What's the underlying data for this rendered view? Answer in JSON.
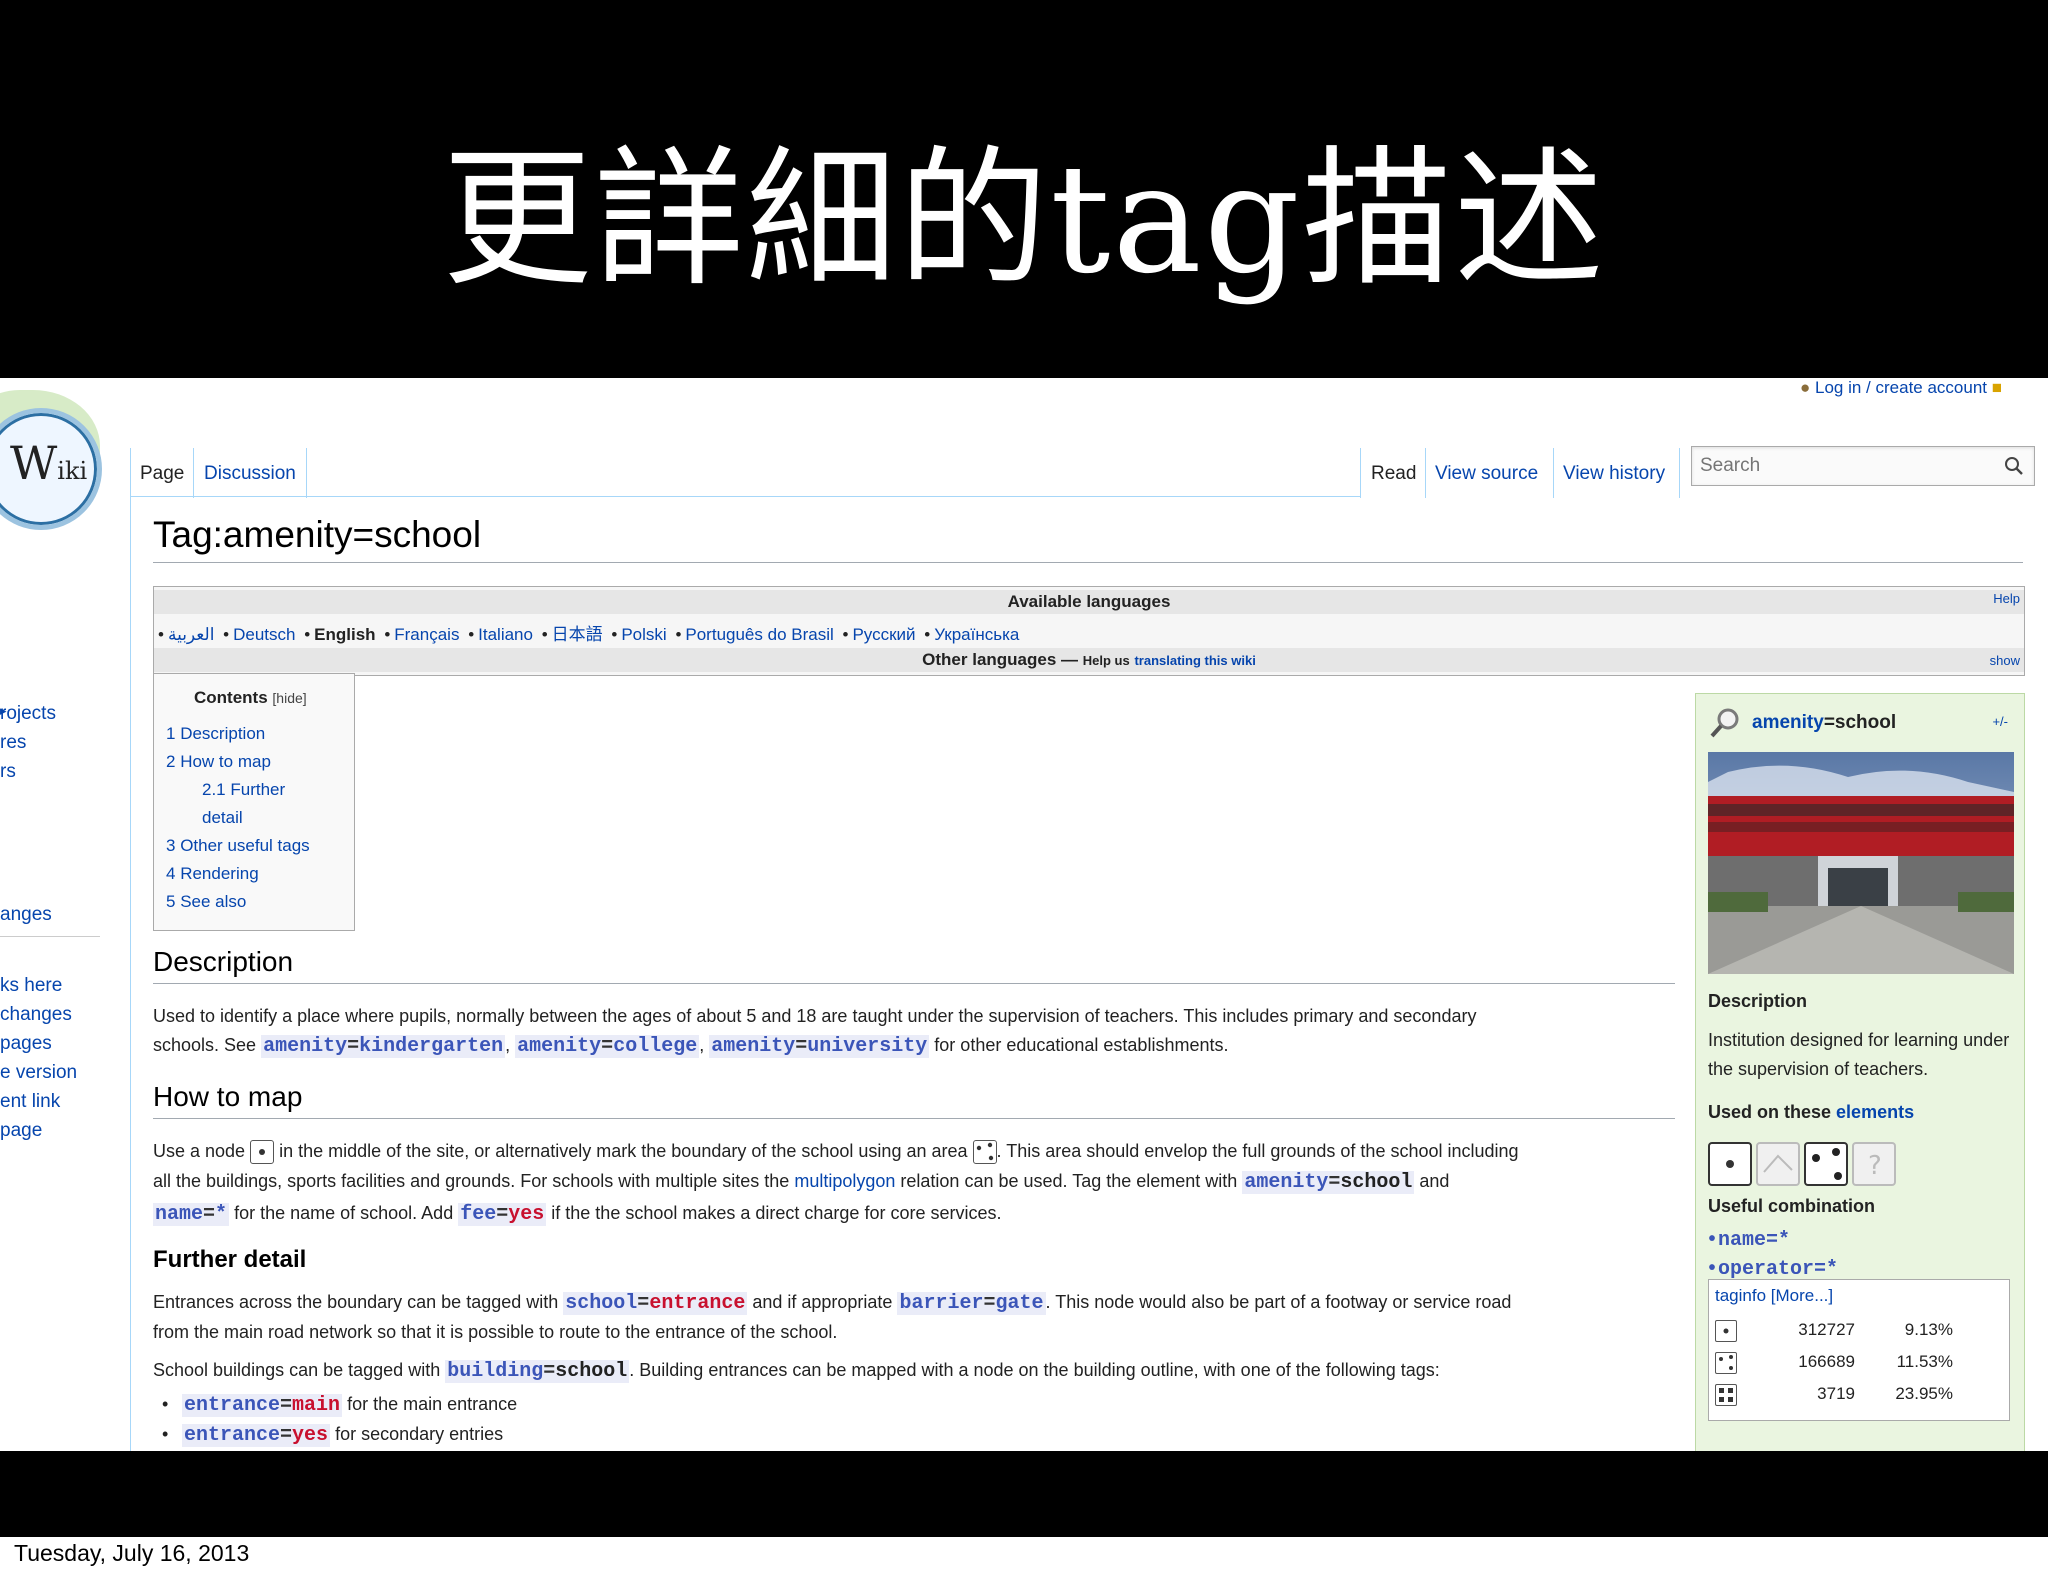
{
  "slide": {
    "title": "更詳細的tag描述",
    "footer_date": "Tuesday, July 16, 2013"
  },
  "wiki": {
    "logo_text": "W",
    "logo_small": "iki",
    "personal": {
      "login": "Log in / create account"
    },
    "sidebar_links": [
      "rojects",
      "res",
      "rs",
      "anges",
      "ks here",
      "changes",
      "pages",
      "e version",
      "ent link",
      "page"
    ],
    "tabs": {
      "page": "Page",
      "discussion": "Discussion",
      "read": "Read",
      "view_source": "View source",
      "view_history": "View history"
    },
    "search": {
      "placeholder": "Search"
    },
    "page_title": "Tag:amenity=school",
    "languages": {
      "heading": "Available languages",
      "help": "Help",
      "items": [
        "العربية",
        "Deutsch",
        "English",
        "Français",
        "Italiano",
        "日本語",
        "Polski",
        "Português do Brasil",
        "Русский",
        "Українська"
      ],
      "separator": "•",
      "other": "Other languages —",
      "translate_prefix": "Help us",
      "translate_link": "translating this wiki",
      "show": "show"
    },
    "toc": {
      "title": "Contents",
      "hide": "[hide]",
      "items": [
        {
          "num": "1",
          "label": "Description"
        },
        {
          "num": "2",
          "label": "How to map"
        },
        {
          "num": "2.1",
          "label": "Further"
        },
        {
          "num": "",
          "label": "detail"
        },
        {
          "num": "3",
          "label": "Other useful tags"
        },
        {
          "num": "4",
          "label": "Rendering"
        },
        {
          "num": "5",
          "label": "See also"
        }
      ]
    },
    "description": {
      "heading": "Description",
      "text1": "Used to identify a place where pupils, normally between the ages of about 5 and 18 are taught under the supervision of teachers. This includes primary and secondary",
      "text2_prefix": "schools. See",
      "tag1_k": "amenity",
      "tag1_v": "kindergarten",
      "tag2_k": "amenity",
      "tag2_v": "college",
      "tag3_k": "amenity",
      "tag3_v": "university",
      "text2_suffix": "for other educational establishments."
    },
    "howto": {
      "heading": "How to map",
      "t1": "Use a node",
      "t2": "in the middle of the site, or alternatively mark the boundary of the school using an area",
      "t3": ". This area should envelop the full grounds of the school including",
      "t4": "all the buildings, sports facilities and grounds. For schools with multiple sites the",
      "multipolygon": "multipolygon",
      "t5": "relation can be used. Tag the element with",
      "tag_k": "amenity",
      "tag_v": "school",
      "t6": "and",
      "name_k": "name",
      "name_v": "*",
      "t7": "for the name of school. Add",
      "fee_k": "fee",
      "fee_v": "yes",
      "t8": "if the the school makes a direct charge for core services."
    },
    "further": {
      "heading": "Further detail",
      "p1a": "Entrances across the boundary can be tagged with",
      "school_k": "school",
      "school_v": "entrance",
      "p1b": "and if appropriate",
      "barrier_k": "barrier",
      "barrier_v": "gate",
      "p1c": ". This node would also be part of a footway or service road",
      "p1d": "from the main road network so that it is possible to route to the entrance of the school.",
      "p2a": "School buildings can be tagged with",
      "building_k": "building",
      "building_v": "school",
      "p2b": ". Building entrances can be mapped with a node on the building outline, with one of the following tags:",
      "bullets": [
        {
          "k": "entrance",
          "v": "main",
          "text": "for the main entrance"
        },
        {
          "k": "entrance",
          "v": "yes",
          "text": "for secondary entries"
        }
      ]
    },
    "infobox": {
      "key": "amenity",
      "value": "=school",
      "plusminus": "+/-",
      "description_label": "Description",
      "description_text": "Institution designed for learning under the supervision of teachers.",
      "used_on_prefix": "Used on these",
      "used_on_link": "elements",
      "useful_label": "Useful combination",
      "combos": [
        "name=*",
        "operator=*"
      ],
      "taginfo": {
        "label": "taginfo",
        "more": "[More...]",
        "rows": [
          {
            "count": "312727",
            "percent": "9.13%"
          },
          {
            "count": "166689",
            "percent": "11.53%"
          },
          {
            "count": "3719",
            "percent": "23.95%"
          }
        ]
      }
    }
  }
}
